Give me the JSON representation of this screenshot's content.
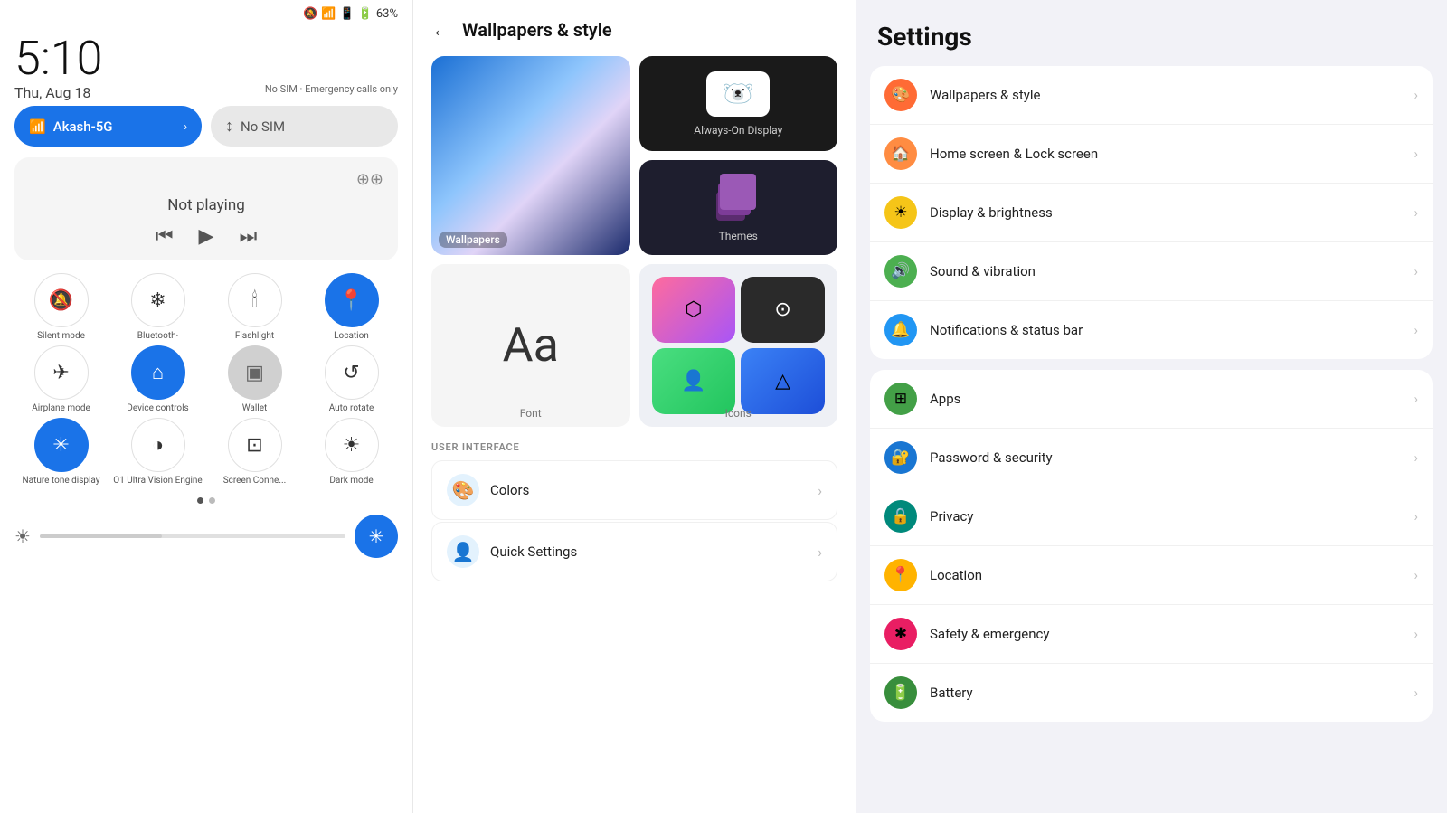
{
  "phone": {
    "status_bar": {
      "time": "5:10",
      "date": "Thu, Aug 18",
      "battery": "63%",
      "sim_notice": "No SIM · Emergency calls only"
    },
    "wifi": {
      "label": "Akash-5G",
      "arrow": "›"
    },
    "sim": {
      "label": "No SIM"
    },
    "media": {
      "not_playing": "Not playing"
    },
    "tiles": [
      {
        "label": "Silent mode",
        "icon": "🔔",
        "active": false
      },
      {
        "label": "Bluetooth·",
        "icon": "❄",
        "active": false
      },
      {
        "label": "Flashlight",
        "icon": "🕯",
        "active": false
      },
      {
        "label": "Location",
        "icon": "📍",
        "active": true
      },
      {
        "label": "Airplane mode",
        "icon": "✈",
        "active": false
      },
      {
        "label": "Device controls",
        "icon": "⌂",
        "active": true
      },
      {
        "label": "Wallet",
        "icon": "▣",
        "active": false
      },
      {
        "label": "Auto rotate",
        "icon": "↺",
        "active": false
      },
      {
        "label": "Nature tone display",
        "icon": "✳",
        "active": true
      },
      {
        "label": "O1 Ultra Vision Engine",
        "icon": "◑",
        "active": false
      },
      {
        "label": "Screen Connect",
        "icon": "⊡",
        "active": false
      },
      {
        "label": "Dark mode",
        "icon": "☀",
        "active": false
      }
    ]
  },
  "middle": {
    "title": "Wallpapers & style",
    "back_label": "←",
    "items": [
      {
        "id": "wallpapers",
        "label": "Wallpapers"
      },
      {
        "id": "aod",
        "label": "Always-On Display"
      },
      {
        "id": "themes",
        "label": "Themes"
      },
      {
        "id": "font",
        "label": "Font"
      },
      {
        "id": "icons",
        "label": "Icons"
      }
    ],
    "section_label": "USER INTERFACE",
    "ui_items": [
      {
        "label": "Colors",
        "icon_color": "#1a73e8"
      },
      {
        "label": "Quick Settings",
        "icon_color": "#1a73e8"
      }
    ]
  },
  "settings": {
    "title": "Settings",
    "items": [
      {
        "label": "Wallpapers & style",
        "icon": "🎨",
        "color": "bg-orange"
      },
      {
        "label": "Home screen & Lock screen",
        "icon": "🏠",
        "color": "bg-orange2"
      },
      {
        "label": "Display & brightness",
        "icon": "☀",
        "color": "bg-yellow"
      },
      {
        "label": "Sound & vibration",
        "icon": "🔊",
        "color": "bg-green"
      },
      {
        "label": "Notifications & status bar",
        "icon": "🔔",
        "color": "bg-blue"
      },
      {
        "label": "Apps",
        "icon": "⊞",
        "color": "bg-green2"
      },
      {
        "label": "Password & security",
        "icon": "🔐",
        "color": "bg-blue2"
      },
      {
        "label": "Privacy",
        "icon": "🔒",
        "color": "bg-teal"
      },
      {
        "label": "Location",
        "icon": "📍",
        "color": "bg-amber"
      },
      {
        "label": "Safety & emergency",
        "icon": "✱",
        "color": "bg-pink"
      },
      {
        "label": "Battery",
        "icon": "🔋",
        "color": "bg-green3"
      }
    ]
  }
}
